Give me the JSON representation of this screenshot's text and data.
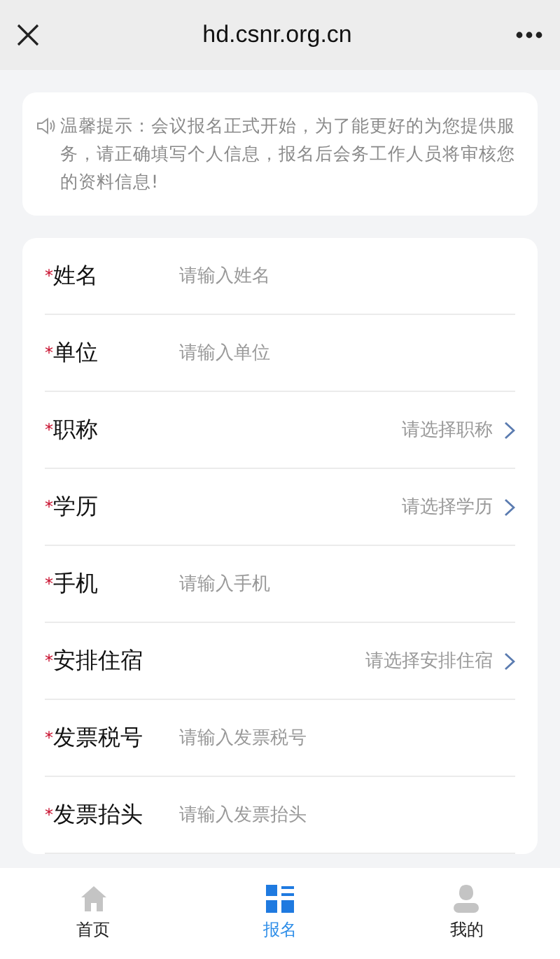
{
  "header": {
    "title": "hd.csnr.org.cn"
  },
  "notice": {
    "text": "温馨提示：会议报名正式开始，为了能更好的为您提供服务，请正确填写个人信息，报名后会务工作人员将审核您的资料信息!"
  },
  "form": {
    "required_mark": "*",
    "fields": [
      {
        "label": "姓名",
        "kind": "input",
        "required": true,
        "placeholder": "请输入姓名"
      },
      {
        "label": "单位",
        "kind": "input",
        "required": true,
        "placeholder": "请输入单位"
      },
      {
        "label": "职称",
        "kind": "select",
        "required": true,
        "placeholder": "请选择职称"
      },
      {
        "label": "学历",
        "kind": "select",
        "required": true,
        "placeholder": "请选择学历"
      },
      {
        "label": "手机",
        "kind": "input",
        "required": true,
        "placeholder": "请输入手机"
      },
      {
        "label": "安排住宿",
        "kind": "select",
        "required": true,
        "placeholder": "请选择安排住宿"
      },
      {
        "label": "发票税号",
        "kind": "input",
        "required": true,
        "placeholder": "请输入发票税号"
      },
      {
        "label": "发票抬头",
        "kind": "input",
        "required": true,
        "placeholder": "请输入发票抬头"
      }
    ]
  },
  "tabs": [
    {
      "label": "首页",
      "kind": "home",
      "selected": false
    },
    {
      "label": "报名",
      "kind": "grid",
      "selected": true
    },
    {
      "label": "我的",
      "kind": "person",
      "selected": false
    }
  ]
}
